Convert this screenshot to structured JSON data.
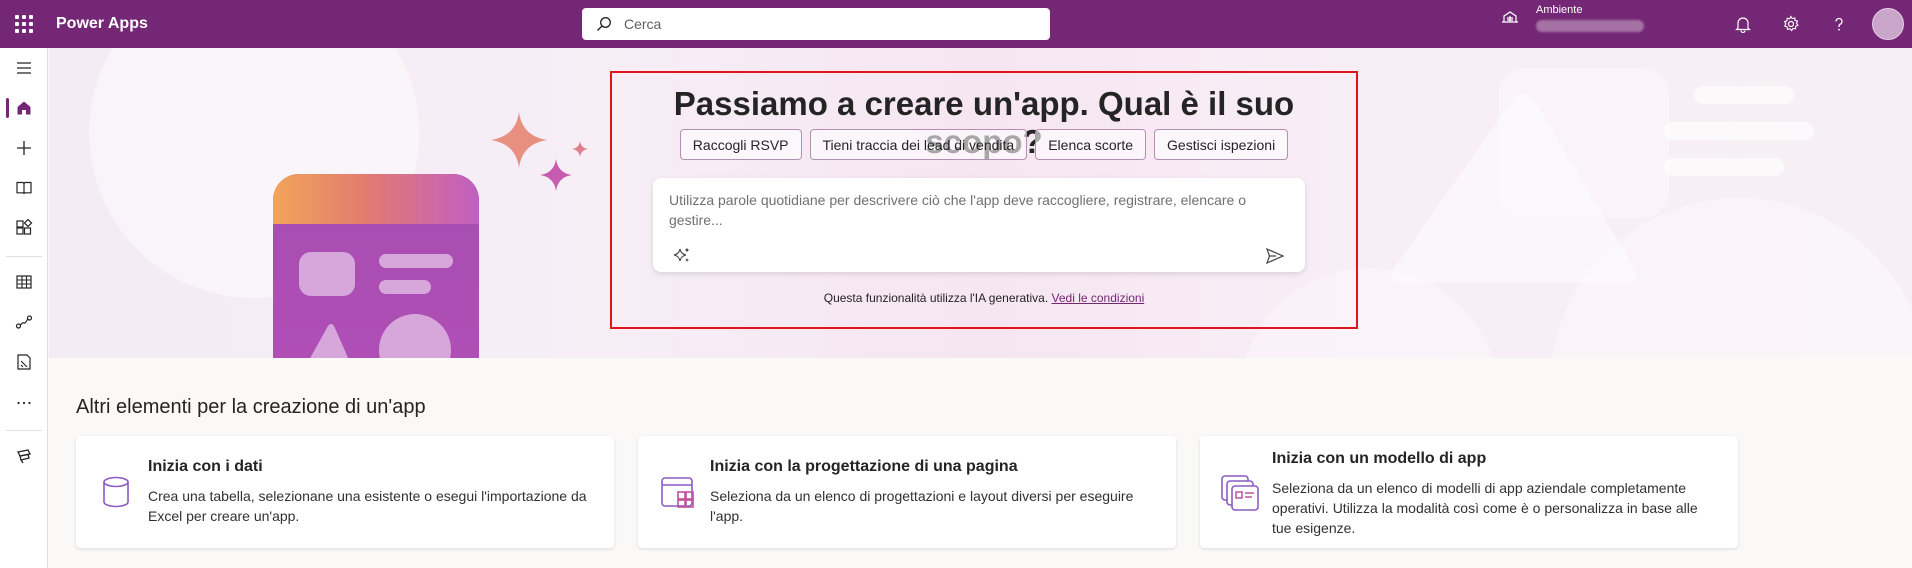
{
  "topbar": {
    "app_name": "Power Apps",
    "search_placeholder": "Cerca",
    "env_label": "Ambiente",
    "brand_color": "#742774"
  },
  "leftnav": {
    "items": [
      "menu-icon",
      "home-icon",
      "create-icon",
      "learn-icon",
      "apps-icon",
      "tables-icon",
      "flows-icon",
      "solutions-icon",
      "more-icon",
      "power-platform-icon"
    ]
  },
  "hero": {
    "title": "Passiamo a creare un'app. Qual è il suo scopo?",
    "chips": [
      "Raccogli RSVP",
      "Tieni traccia dei lead di vendita",
      "Elenca scorte",
      "Gestisci ispezioni"
    ],
    "prompt_placeholder": "Utilizza parole quotidiane per descrivere ciò che l'app deve raccogliere, registrare, elencare o gestire...",
    "disclaimer_text": "Questa funzionalità utilizza l'IA generativa.",
    "disclaimer_link": "Vedi le condizioni"
  },
  "section": {
    "title": "Altri elementi per la creazione di un'app",
    "cards": [
      {
        "title": "Inizia con i dati",
        "desc": "Crea una tabella, selezionane una esistente o esegui l'importazione da Excel per creare un'app."
      },
      {
        "title": "Inizia con la progettazione di una pagina",
        "desc": "Seleziona da un elenco di progettazioni e layout diversi per eseguire l'app."
      },
      {
        "title": "Inizia con un modello di app",
        "desc": "Seleziona da un elenco di modelli di app aziendale completamente operativi. Utilizza la modalità così come è o personalizza in base alle tue esigenze."
      }
    ]
  }
}
